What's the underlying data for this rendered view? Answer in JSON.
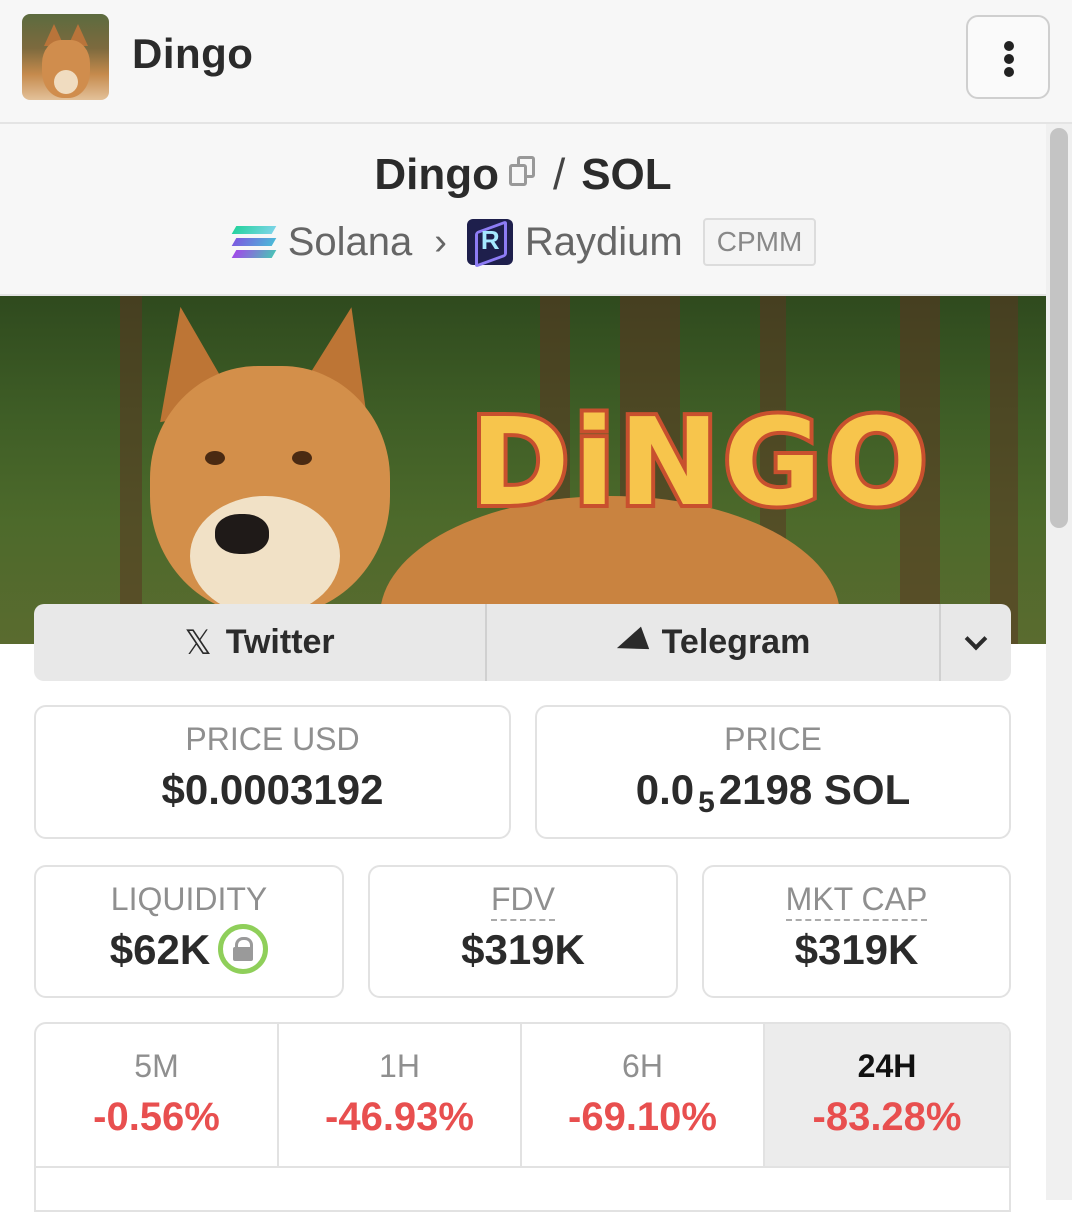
{
  "header": {
    "title": "Dingo"
  },
  "pair": {
    "base": "Dingo",
    "separator": "/",
    "quote": "SOL",
    "chain": "Solana",
    "dex": "Raydium",
    "pool_type": "CPMM"
  },
  "banner": {
    "logo_text": "DiNGO"
  },
  "links": {
    "twitter": "Twitter",
    "telegram": "Telegram"
  },
  "price": {
    "usd_label": "PRICE USD",
    "usd_value": "$0.0003192",
    "native_label": "PRICE",
    "native_prefix": "0.0",
    "native_zero_count": "5",
    "native_digits": "2198",
    "native_unit": "SOL"
  },
  "stats": {
    "liquidity_label": "LIQUIDITY",
    "liquidity_value": "$62K",
    "fdv_label": "FDV",
    "fdv_value": "$319K",
    "mktcap_label": "MKT CAP",
    "mktcap_value": "$319K"
  },
  "changes": [
    {
      "period": "5M",
      "value": "-0.56%"
    },
    {
      "period": "1H",
      "value": "-46.93%"
    },
    {
      "period": "6H",
      "value": "-69.10%"
    },
    {
      "period": "24H",
      "value": "-83.28%"
    }
  ],
  "colors": {
    "negative": "#e84f4f",
    "lock_ring": "#8fcf5a"
  }
}
